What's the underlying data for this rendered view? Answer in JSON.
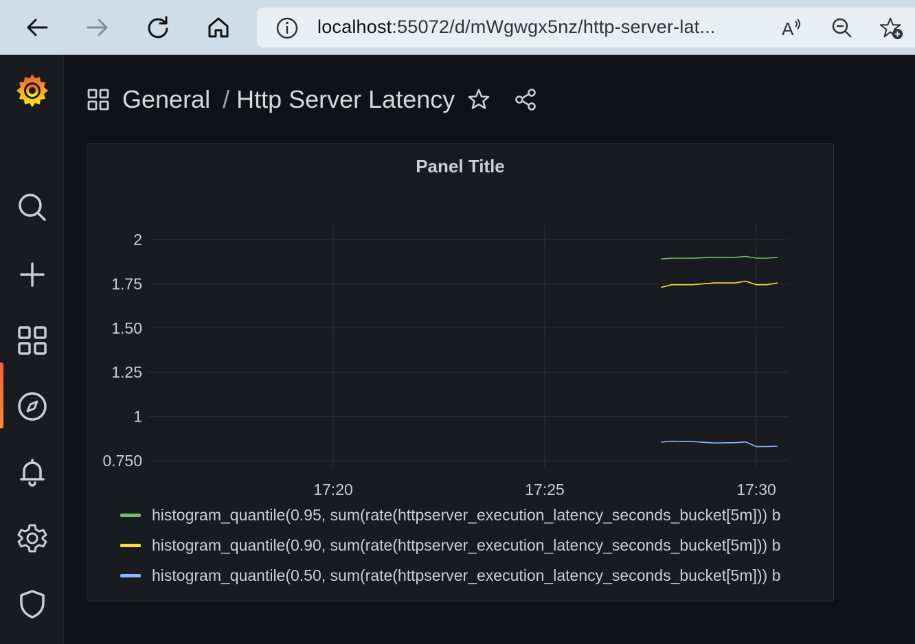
{
  "browser": {
    "url_host": "localhost",
    "url_rest": ":55072/d/mWgwgx5nz/http-server-lat..."
  },
  "breadcrumb": {
    "folder": "General",
    "separator": "/",
    "dashboard": "Http Server Latency"
  },
  "panel": {
    "title": "Panel Title"
  },
  "colors": {
    "accent": "#f55f3e",
    "series_p95": "#73bf69",
    "series_p90": "#fade2a",
    "series_p50": "#8ab8ff"
  },
  "chart_data": {
    "type": "line",
    "title": "Panel Title",
    "xlabel": "",
    "ylabel": "",
    "ylim": [
      0.75,
      2.0
    ],
    "yticks": [
      "0.750",
      "1",
      "1.25",
      "1.50",
      "1.75",
      "2"
    ],
    "xticks": [
      "17:20",
      "17:25",
      "17:30"
    ],
    "x": [
      "17:27:45",
      "17:28:00",
      "17:28:30",
      "17:29:00",
      "17:29:30",
      "17:29:45",
      "17:30:00",
      "17:30:15",
      "17:30:30"
    ],
    "grid": true,
    "legend_position": "bottom",
    "series": [
      {
        "name": "histogram_quantile(0.95, sum(rate(httpserver_execution_latency_seconds_bucket[5m])) b",
        "color": "#73bf69",
        "values": [
          1.89,
          1.895,
          1.895,
          1.9,
          1.9,
          1.905,
          1.895,
          1.895,
          1.9
        ]
      },
      {
        "name": "histogram_quantile(0.90, sum(rate(httpserver_execution_latency_seconds_bucket[5m])) b",
        "color": "#fade2a",
        "values": [
          1.73,
          1.745,
          1.745,
          1.755,
          1.755,
          1.765,
          1.745,
          1.745,
          1.755
        ]
      },
      {
        "name": "histogram_quantile(0.50, sum(rate(httpserver_execution_latency_seconds_bucket[5m])) b",
        "color": "#8ab8ff",
        "values": [
          0.855,
          0.86,
          0.858,
          0.85,
          0.852,
          0.856,
          0.83,
          0.83,
          0.832
        ]
      }
    ]
  }
}
